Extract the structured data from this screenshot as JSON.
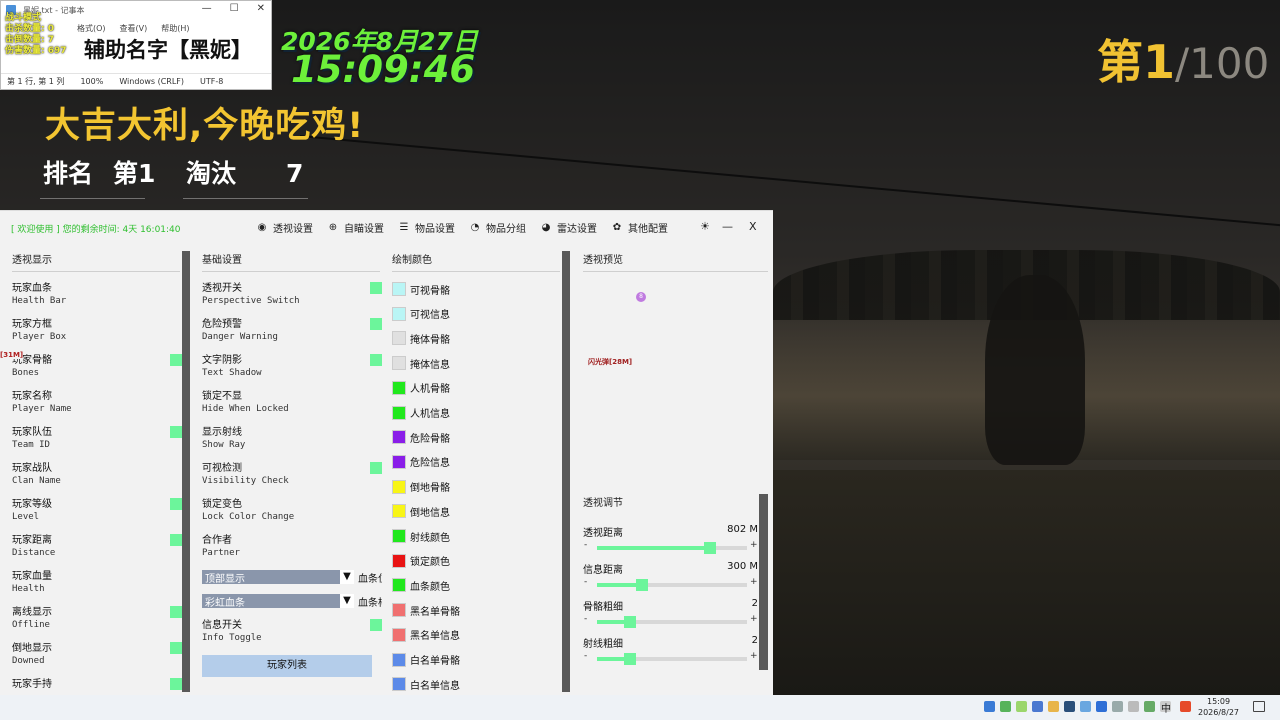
{
  "notepad": {
    "title": "黑妮.txt - 记事本",
    "menu": [
      "文件(F)",
      "编辑(E)",
      "格式(O)",
      "查看(V)",
      "帮助(H)"
    ],
    "status": [
      "第 1 行, 第 1 列",
      "100%",
      "Windows (CRLF)",
      "UTF-8"
    ],
    "overlay": [
      "战斗模式",
      "击杀数量: 0",
      "击倒数量: 7",
      "伤害数量: 697"
    ]
  },
  "hud": {
    "assist_name": "辅助名字【黑妮】",
    "date": "2026年8月27日",
    "time": "15:09:46",
    "rank_main": "第1",
    "rank_total": "/100",
    "slogan": "大吉大利,今晚吃鸡!",
    "rank_label": "排名",
    "rank_value": "第1",
    "kills_label": "淘汰",
    "kills_value": "7"
  },
  "panel": {
    "welcome": "[ 欢迎使用 ] 您的剩余时间: 4天 16:01:40",
    "tabs": [
      {
        "label": "透视设置",
        "icon": "eye-icon"
      },
      {
        "label": "自瞄设置",
        "icon": "target-icon"
      },
      {
        "label": "物品设置",
        "icon": "sliders-icon"
      },
      {
        "label": "物品分组",
        "icon": "group-icon"
      },
      {
        "label": "雷达设置",
        "icon": "radar-icon"
      },
      {
        "label": "其他配置",
        "icon": "gear-icon"
      }
    ],
    "window_controls": {
      "theme": "☀",
      "minimize": "—",
      "close": "X"
    },
    "col1": {
      "title": "透视显示",
      "items": [
        {
          "cn": "玩家血条",
          "en": "Health Bar",
          "on": false
        },
        {
          "cn": "玩家方框",
          "en": "Player Box",
          "on": false
        },
        {
          "cn": "玩家骨骼",
          "en": "Bones",
          "on": true
        },
        {
          "cn": "玩家名称",
          "en": "Player Name",
          "on": false
        },
        {
          "cn": "玩家队伍",
          "en": "Team ID",
          "on": true
        },
        {
          "cn": "玩家战队",
          "en": "Clan Name",
          "on": false
        },
        {
          "cn": "玩家等级",
          "en": "Level",
          "on": true
        },
        {
          "cn": "玩家距离",
          "en": "Distance",
          "on": true
        },
        {
          "cn": "玩家血量",
          "en": "Health",
          "on": false
        },
        {
          "cn": "离线显示",
          "en": "Offline",
          "on": true
        },
        {
          "cn": "倒地显示",
          "en": "Downed",
          "on": true
        },
        {
          "cn": "玩家手持",
          "en": "",
          "on": true
        }
      ]
    },
    "col2": {
      "title": "基础设置",
      "items": [
        {
          "cn": "透视开关",
          "en": "Perspective Switch",
          "on": true
        },
        {
          "cn": "危险预警",
          "en": "Danger Warning",
          "on": true
        },
        {
          "cn": "文字阴影",
          "en": "Text Shadow",
          "on": true
        },
        {
          "cn": "锁定不显",
          "en": "Hide When Locked",
          "on": false
        },
        {
          "cn": "显示射线",
          "en": "Show Ray",
          "on": false
        },
        {
          "cn": "可视检测",
          "en": "Visibility Check",
          "on": true
        },
        {
          "cn": "锁定变色",
          "en": "Lock Color Change",
          "on": false
        },
        {
          "cn": "合作者",
          "en": "Partner",
          "on": false
        }
      ],
      "dropdown1": {
        "value": "顶部显示",
        "label": "血条位"
      },
      "dropdown2": {
        "value": "彩虹血条",
        "label": "血条样"
      },
      "info_toggle": {
        "cn": "信息开关",
        "en": "Info Toggle",
        "on": true
      },
      "player_list_button": "玩家列表"
    },
    "col3": {
      "title": "绘制颜色",
      "items": [
        {
          "label": "可视骨骼",
          "color": "#b9f5f5"
        },
        {
          "label": "可视信息",
          "color": "#b9f5f5"
        },
        {
          "label": "掩体骨骼",
          "color": "#e0e0e0"
        },
        {
          "label": "掩体信息",
          "color": "#e0e0e0"
        },
        {
          "label": "人机骨骼",
          "color": "#21e81d"
        },
        {
          "label": "人机信息",
          "color": "#21e81d"
        },
        {
          "label": "危险骨骼",
          "color": "#8a1ee8"
        },
        {
          "label": "危险信息",
          "color": "#8a1ee8"
        },
        {
          "label": "倒地骨骼",
          "color": "#f8f516"
        },
        {
          "label": "倒地信息",
          "color": "#f8f516"
        },
        {
          "label": "射线颜色",
          "color": "#21e81d"
        },
        {
          "label": "锁定颜色",
          "color": "#e81313"
        },
        {
          "label": "血条颜色",
          "color": "#21e81d"
        },
        {
          "label": "黑名单骨骼",
          "color": "#f07070"
        },
        {
          "label": "黑名单信息",
          "color": "#f07070"
        },
        {
          "label": "白名单骨骼",
          "color": "#5c8ae8"
        },
        {
          "label": "白名单信息",
          "color": "#5c8ae8"
        }
      ]
    },
    "col4": {
      "title": "透视预览",
      "preview_dot": "8",
      "preview_name": "闪光弹[28M]",
      "red_tag": "[31M]",
      "adjust_title": "透视调节",
      "sliders": [
        {
          "label": "透视距离",
          "value": "802 M",
          "fraction": 0.75
        },
        {
          "label": "信息距离",
          "value": "300 M",
          "fraction": 0.3
        },
        {
          "label": "骨骼粗细",
          "value": "2",
          "fraction": 0.22
        },
        {
          "label": "射线粗细",
          "value": "2",
          "fraction": 0.22
        }
      ],
      "minus": "-",
      "plus": "+"
    }
  },
  "taskbar": {
    "ime": "中",
    "clock_time": "15:09",
    "clock_date": "2026/8/27"
  }
}
